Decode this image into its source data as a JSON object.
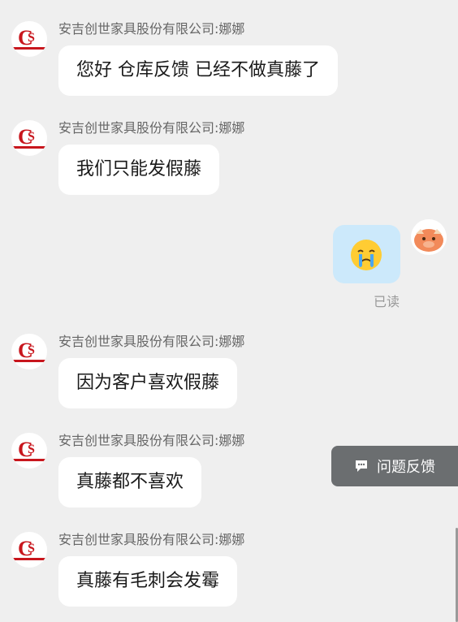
{
  "messages": [
    {
      "sender": "安吉创世家具股份有限公司:娜娜",
      "text": "您好 仓库反馈 已经不做真藤了"
    },
    {
      "sender": "安吉创世家具股份有限公司:娜娜",
      "text": "我们只能发假藤"
    },
    {
      "sender": "安吉创世家具股份有限公司:娜娜",
      "text": "因为客户喜欢假藤"
    },
    {
      "sender": "安吉创世家具股份有限公司:娜娜",
      "text": "真藤都不喜欢"
    },
    {
      "sender": "安吉创世家具股份有限公司:娜娜",
      "text": "真藤有毛刺会发霉"
    }
  ],
  "my_message": {
    "emoji": "crying-face-emoji",
    "status": "已读"
  },
  "feedback_button": {
    "label": "问题反馈",
    "icon": "chat-bubble-icon"
  },
  "colors": {
    "background": "#efefef",
    "my_bubble": "#cce9fb",
    "logo_red": "#c8161d"
  }
}
